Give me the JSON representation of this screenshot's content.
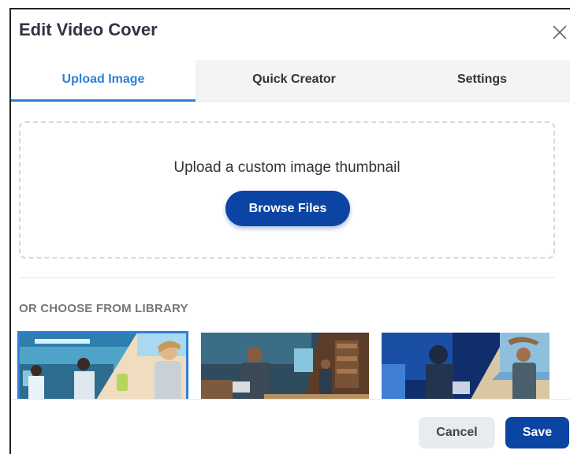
{
  "dialog": {
    "title": "Edit Video Cover",
    "close_icon": "close-icon"
  },
  "tabs": [
    {
      "label": "Upload Image",
      "active": true
    },
    {
      "label": "Quick Creator",
      "active": false
    },
    {
      "label": "Settings",
      "active": false
    }
  ],
  "upload": {
    "prompt": "Upload a custom image thumbnail",
    "browse_label": "Browse Files"
  },
  "library": {
    "heading": "OR CHOOSE FROM LIBRARY",
    "selected_index": 0,
    "thumbnails": [
      {
        "name": "lab-and-beach-thumbnail"
      },
      {
        "name": "workshop-thumbnail"
      },
      {
        "name": "office-and-beach-thumbnail"
      }
    ]
  },
  "footer": {
    "cancel_label": "Cancel",
    "save_label": "Save"
  },
  "colors": {
    "accent": "#2f80d6",
    "primary": "#0b44a3"
  }
}
